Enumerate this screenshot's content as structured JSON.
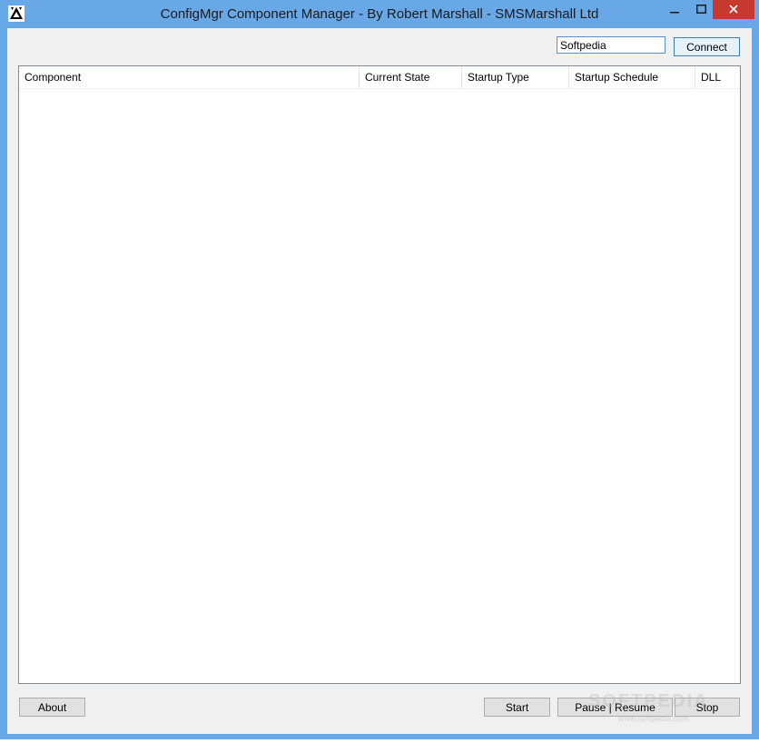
{
  "window": {
    "title": "ConfigMgr Component Manager - By Robert Marshall - SMSMarshall Ltd",
    "controls": {
      "minimize": "minimize-icon",
      "maximize": "maximize-icon",
      "close": "close-icon"
    }
  },
  "toolbar": {
    "server_value": "Softpedia",
    "connect_label": "Connect"
  },
  "listview": {
    "columns": [
      "Component",
      "Current State",
      "Startup Type",
      "Startup Schedule",
      "DLL"
    ],
    "rows": []
  },
  "footer": {
    "about_label": "About",
    "start_label": "Start",
    "pause_resume_label": "Pause | Resume",
    "stop_label": "Stop"
  },
  "watermark": {
    "text": "SOFTPEDIA",
    "url": "www.softpedia.com"
  },
  "colors": {
    "titlebar": "#69a8e6",
    "close_button": "#c7382f",
    "client_bg": "#f0f0f0"
  }
}
